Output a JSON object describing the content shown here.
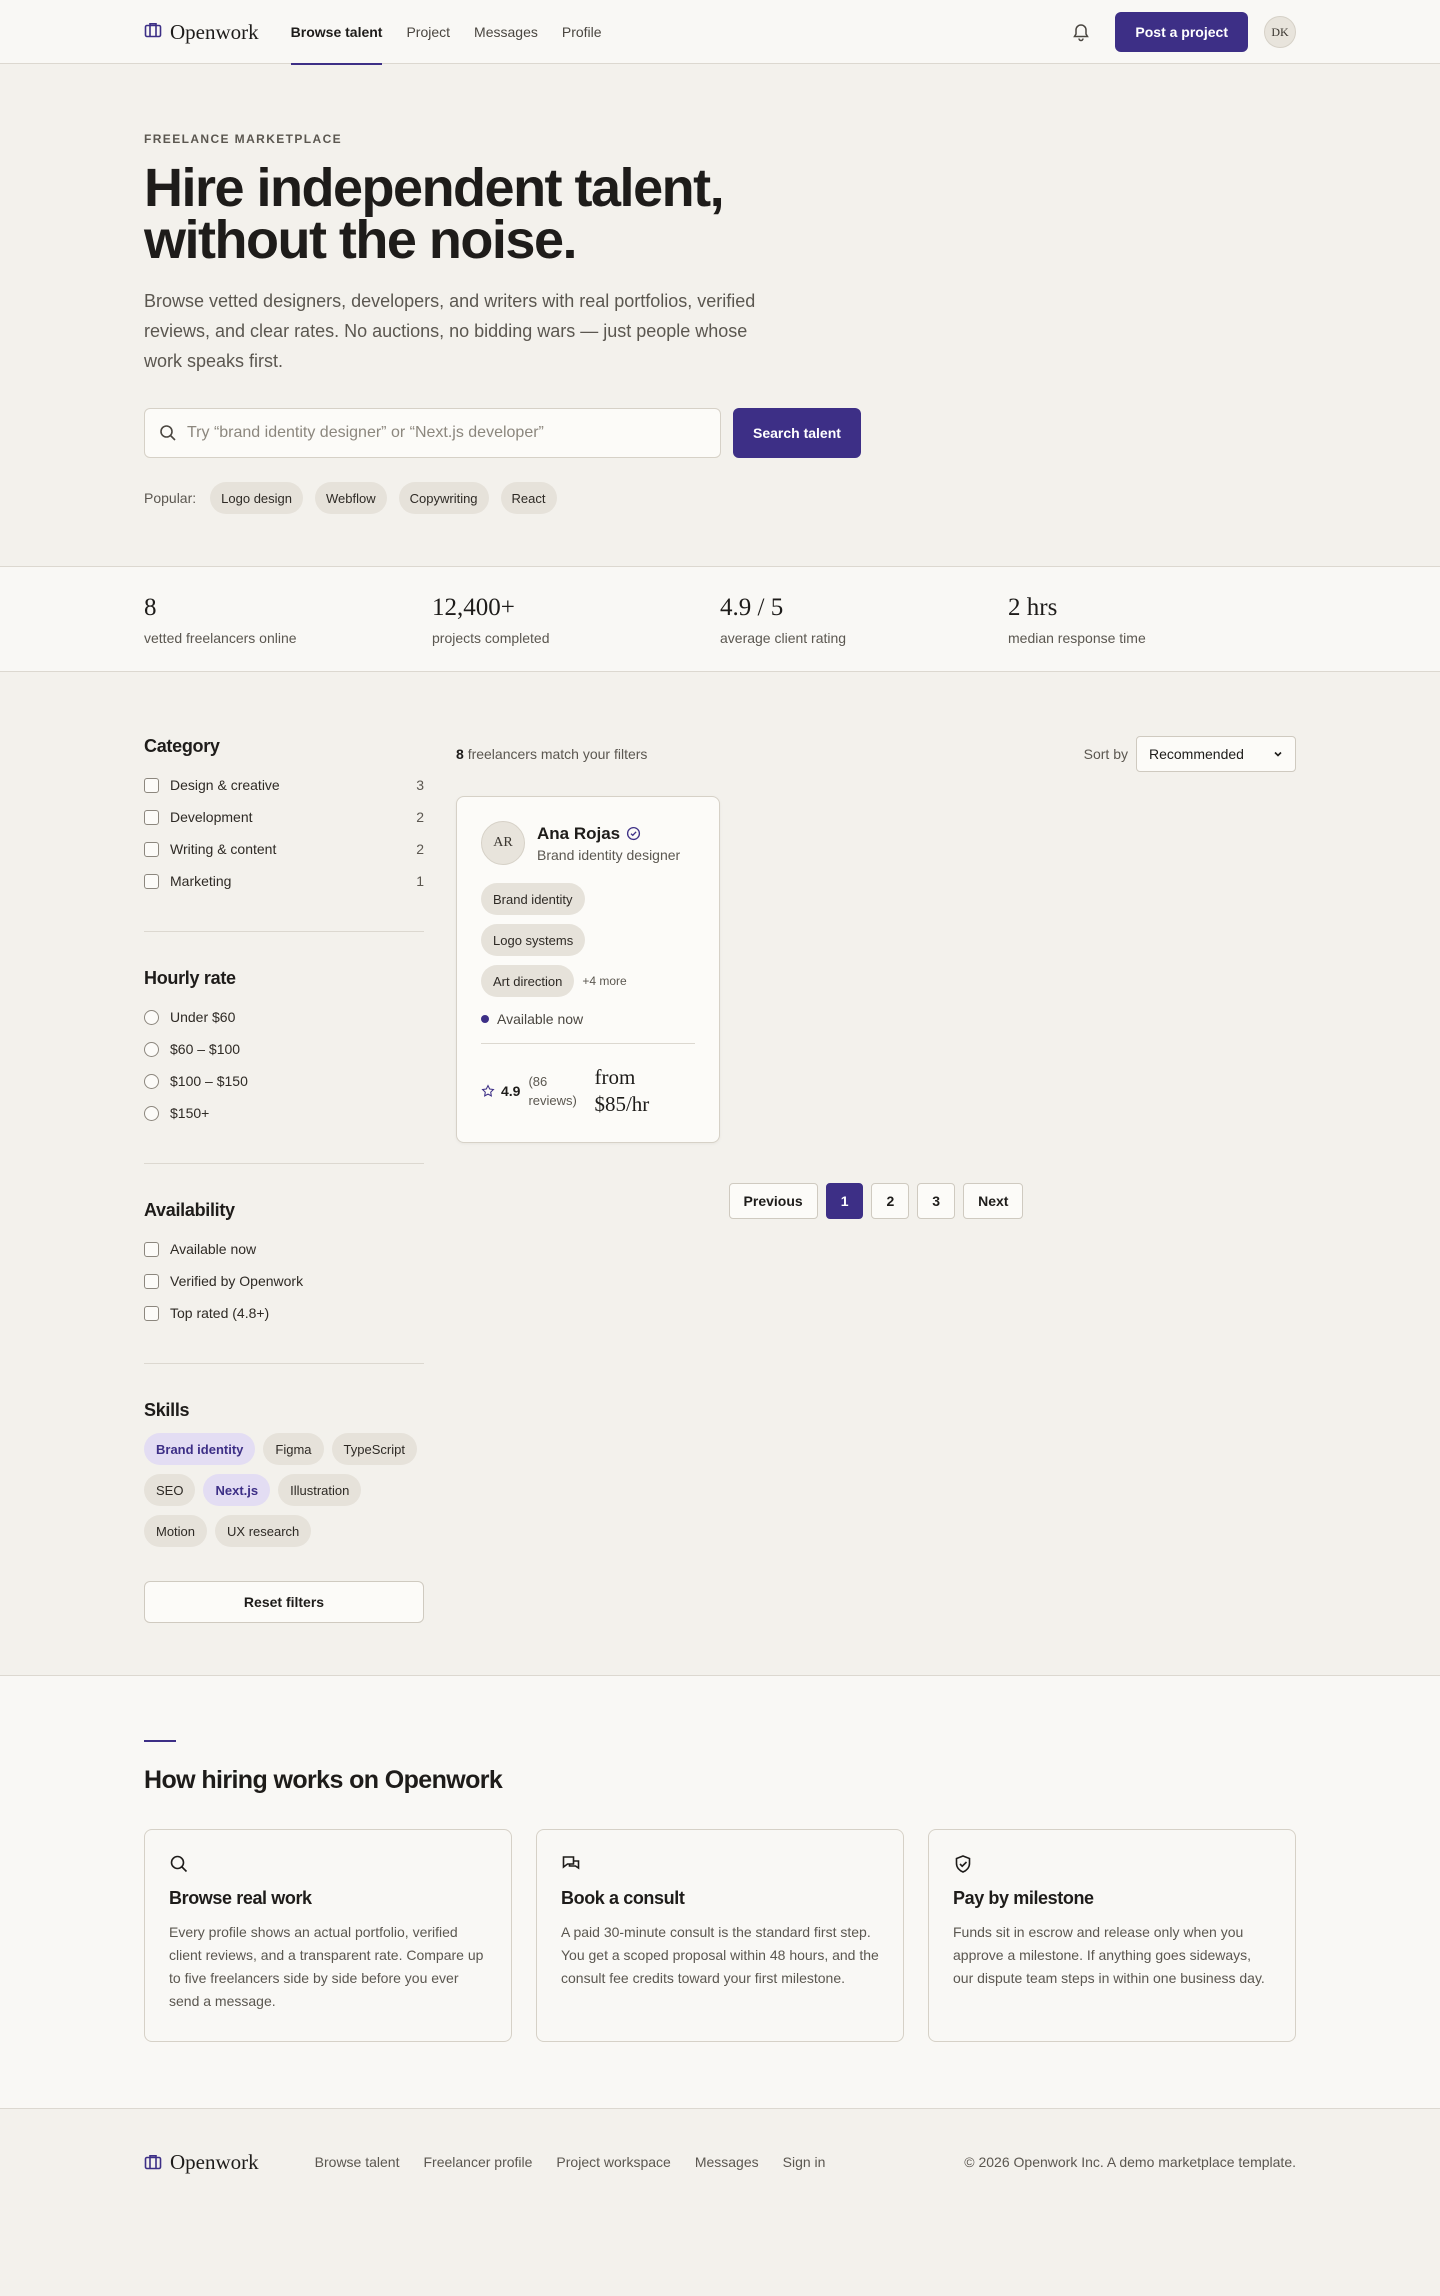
{
  "colors": {
    "accent": "#3d2f86",
    "background": "#f3f1ec",
    "surface": "#f9f8f5",
    "chip": "#e6e2da",
    "selected_chip": "#e3ddf3"
  },
  "header": {
    "brand": "Openwork",
    "nav": [
      {
        "label": "Browse talent",
        "active": true
      },
      {
        "label": "Project",
        "active": false
      },
      {
        "label": "Messages",
        "active": false
      },
      {
        "label": "Profile",
        "active": false
      }
    ],
    "cta": "Post a project",
    "avatar_initials": "DK"
  },
  "hero": {
    "eyebrow": "FREELANCE MARKETPLACE",
    "title": "Hire independent talent, without the noise.",
    "lead": "Browse vetted designers, developers, and writers with real portfolios, verified reviews, and clear rates. No auctions, no bidding wars — just people whose work speaks first.",
    "search_placeholder": "Try “brand identity designer” or “Next.js developer”",
    "search_value": "",
    "search_button": "Search talent",
    "popular_label": "Popular:",
    "popular": [
      "Logo design",
      "Webflow",
      "Copywriting",
      "React"
    ]
  },
  "stats": [
    {
      "value": "8",
      "label": "vetted freelancers online"
    },
    {
      "value": "12,400+",
      "label": "projects completed"
    },
    {
      "value": "4.9 / 5",
      "label": "average client rating"
    },
    {
      "value": "2 hrs",
      "label": "median response time"
    }
  ],
  "filters": {
    "category": {
      "title": "Category",
      "options": [
        {
          "label": "Design & creative",
          "count": "3"
        },
        {
          "label": "Development",
          "count": "2"
        },
        {
          "label": "Writing & content",
          "count": "2"
        },
        {
          "label": "Marketing",
          "count": "1"
        }
      ]
    },
    "rate": {
      "title": "Hourly rate",
      "options": [
        "Under $60",
        "$60 – $100",
        "$100 – $150",
        "$150+"
      ]
    },
    "availability": {
      "title": "Availability",
      "options": [
        "Available now",
        "Verified by Openwork",
        "Top rated (4.8+)"
      ]
    },
    "skills": {
      "title": "Skills",
      "items": [
        {
          "label": "Brand identity",
          "selected": true
        },
        {
          "label": "Figma",
          "selected": false
        },
        {
          "label": "TypeScript",
          "selected": false
        },
        {
          "label": "SEO",
          "selected": false
        },
        {
          "label": "Next.js",
          "selected": true
        },
        {
          "label": "Illustration",
          "selected": false
        },
        {
          "label": "Motion",
          "selected": false
        },
        {
          "label": "UX research",
          "selected": false
        }
      ]
    },
    "reset_label": "Reset filters"
  },
  "results": {
    "count": "8",
    "count_suffix": "freelancers match your filters",
    "sort_label": "Sort by",
    "sort_value": "Recommended",
    "card": {
      "initials": "AR",
      "name": "Ana Rojas",
      "role": "Brand identity designer",
      "tags": [
        "Brand identity",
        "Logo systems",
        "Art direction"
      ],
      "more": "+4 more",
      "availability": "Available now",
      "rating": "4.9",
      "reviews": "(86 reviews)",
      "price": "from $85/hr"
    },
    "pagination": {
      "previous": "Previous",
      "pages": [
        "1",
        "2",
        "3"
      ],
      "current": "1",
      "next": "Next"
    }
  },
  "how": {
    "title": "How hiring works on Openwork",
    "cards": [
      {
        "icon": "search-icon",
        "title": "Browse real work",
        "text": "Every profile shows an actual portfolio, verified client reviews, and a transparent rate. Compare up to five freelancers side by side before you ever send a message."
      },
      {
        "icon": "chat-icon",
        "title": "Book a consult",
        "text": "A paid 30-minute consult is the standard first step. You get a scoped proposal within 48 hours, and the consult fee credits toward your first milestone."
      },
      {
        "icon": "shield-check-icon",
        "title": "Pay by milestone",
        "text": "Funds sit in escrow and release only when you approve a milestone. If anything goes sideways, our dispute team steps in within one business day."
      }
    ]
  },
  "footer": {
    "brand": "Openwork",
    "links": [
      "Browse talent",
      "Freelancer profile",
      "Project workspace",
      "Messages",
      "Sign in"
    ],
    "copyright": "© 2026 Openwork Inc. A demo marketplace template."
  }
}
